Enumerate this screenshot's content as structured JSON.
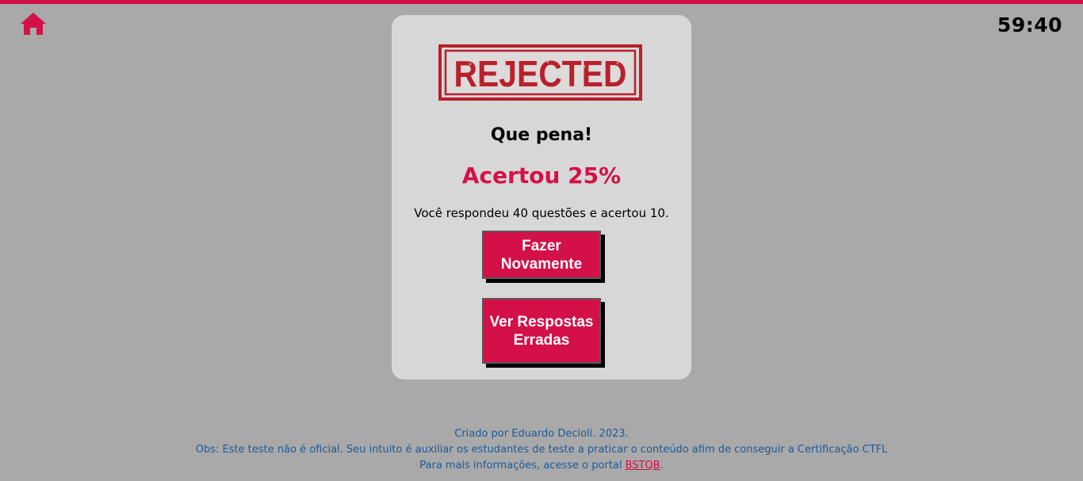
{
  "timer": "59:40",
  "icons": {
    "home": "home-icon"
  },
  "colors": {
    "accent": "#d31047",
    "background": "#a9a9a9",
    "card": "#d7d7d7",
    "footer_text": "#1c5a9c"
  },
  "result": {
    "stamp_text": "REJECTED",
    "headline": "Que pena!",
    "score": "Acertou 25%",
    "summary": "Você respondeu 40 questões e acertou 10."
  },
  "buttons": {
    "retry_label": "Fazer Novamente",
    "wrong_answers_label": "Ver Respostas Erradas"
  },
  "footer": {
    "credit": "Criado por Eduardo Decioli. 2023.",
    "note": "Obs: Este teste não é oficial. Seu intuito é auxiliar os estudantes de teste a praticar o conteúdo afim de conseguir a Certificação CTFL",
    "info_prefix": "Para mais informações, acesse o portal ",
    "portal_link": "BSTQB",
    "info_suffix": "."
  }
}
